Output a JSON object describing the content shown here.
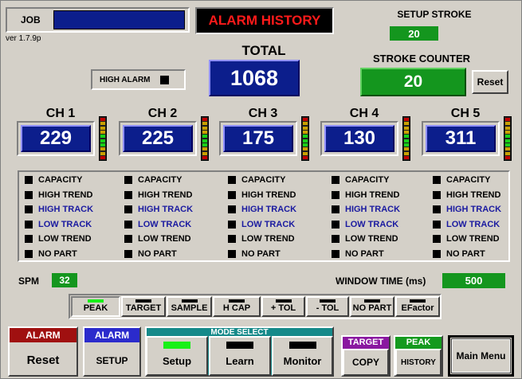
{
  "header": {
    "job_label": "JOB",
    "version": "ver 1.7.9p",
    "alarm_history_label": "ALARM HISTORY",
    "setup_stroke_label": "SETUP STROKE",
    "setup_stroke_value": "20",
    "total_label": "TOTAL",
    "total_value": "1068",
    "stroke_counter_label": "STROKE COUNTER",
    "stroke_counter_value": "20",
    "reset_label": "Reset",
    "high_alarm_label": "HIGH ALARM"
  },
  "channels": [
    {
      "label": "CH 1",
      "value": "229"
    },
    {
      "label": "CH 2",
      "value": "225"
    },
    {
      "label": "CH 3",
      "value": "175"
    },
    {
      "label": "CH 4",
      "value": "130"
    },
    {
      "label": "CH 5",
      "value": "311"
    }
  ],
  "alarm_labels": [
    "CAPACITY",
    "HIGH TREND",
    "HIGH TRACK",
    "LOW TRACK",
    "LOW TREND",
    "NO PART"
  ],
  "colors": {
    "blue_display": "#0c1e8c",
    "green_display": "#14961e",
    "alarm_red": "#a01010",
    "track_text": "#1a1aa0",
    "led_green": "#18f018"
  },
  "spm": {
    "label": "SPM",
    "value": "32"
  },
  "window_time": {
    "label": "WINDOW TIME (ms)",
    "value": "500"
  },
  "mode_tabs": [
    "PEAK",
    "TARGET",
    "SAMPLE",
    "H CAP",
    "+ TOL",
    "- TOL",
    "NO PART",
    "EFactor"
  ],
  "bottom": {
    "alarm_reset_header": "ALARM",
    "alarm_reset_label": "Reset",
    "alarm_setup_header": "ALARM",
    "alarm_setup_label": "SETUP",
    "mode_select_header": "MODE SELECT",
    "mode_setup_label": "Setup",
    "mode_learn_label": "Learn",
    "mode_monitor_label": "Monitor",
    "target_header": "TARGET",
    "target_copy_label": "COPY",
    "peak_header": "PEAK",
    "peak_history_label": "HISTORY",
    "main_menu_label": "Main Menu"
  }
}
